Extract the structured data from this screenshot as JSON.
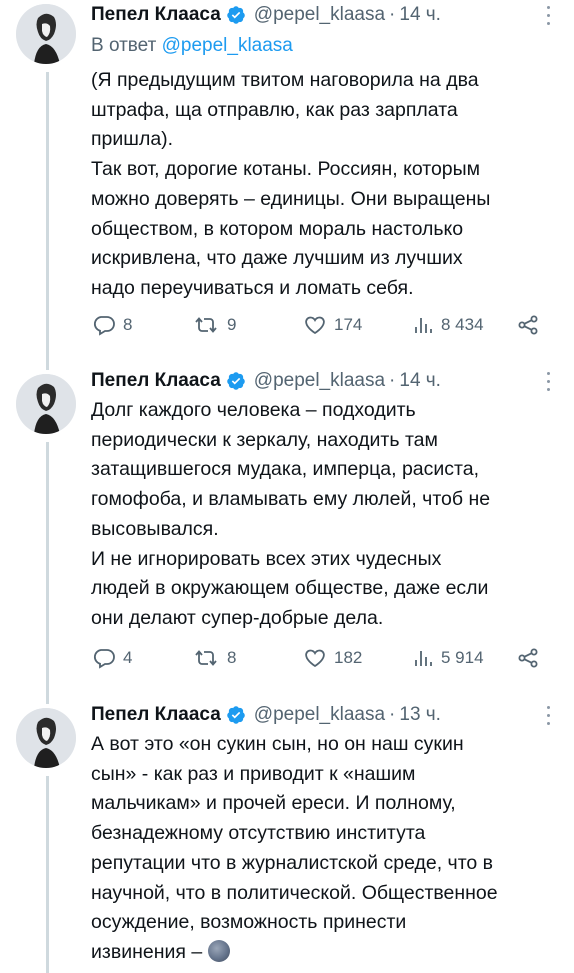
{
  "tweets": [
    {
      "author_name": "Пепел Клааса",
      "handle": "@pepel_klaasa",
      "separator": "·",
      "time": "14 ч.",
      "reply_prefix": "В ответ",
      "reply_handle": "@pepel_klaasa",
      "lines": [
        "(Я предыдущим твитом наговорила на два",
        "штрафа, ща отправлю, как раз зарплата",
        "пришла).",
        "Так вот, дорогие котаны. Россиян, которым",
        "можно доверять – единицы. Они выращены",
        "обществом, в котором мораль настолько",
        "искривлена, что даже лучшим из лучших",
        "надо переучиваться и ломать себя."
      ],
      "replies": "8",
      "retweets": "9",
      "likes": "174",
      "views": "8 434"
    },
    {
      "author_name": "Пепел Клааса",
      "handle": "@pepel_klaasa",
      "separator": "·",
      "time": "14 ч.",
      "lines": [
        "Долг каждого человека – подходить",
        "периодически к зеркалу, находить там",
        "затащившегося мудака, имперца, расиста,",
        "гомофоба, и вламывать ему люлей, чтоб не",
        "высовывался.",
        "И не игнорировать всех этих чудесных",
        "людей в окружающем обществе, даже если",
        "они делают супер-добрые дела."
      ],
      "replies": "4",
      "retweets": "8",
      "likes": "182",
      "views": "5 914"
    },
    {
      "author_name": "Пепел Клааса",
      "handle": "@pepel_klaasa",
      "separator": "·",
      "time": "13 ч.",
      "lines": [
        "А вот это «он сукин сын, но он наш сукин",
        "сын» - как раз и приводит к «нашим",
        "мальчикам» и прочей ереси. И полному,",
        "безнадежному отсутствию института",
        "репутации что в журналистской среде, что в",
        "научной, что в политической. Общественное",
        "осуждение, возможность принести",
        "извинения –"
      ],
      "trailing_emoji": "new-moon-face"
    }
  ],
  "colors": {
    "text": "#0f1419",
    "muted": "#536471",
    "link": "#1d9bf0",
    "verified": "#1d9bf0",
    "thread_line": "#cfd9de"
  }
}
